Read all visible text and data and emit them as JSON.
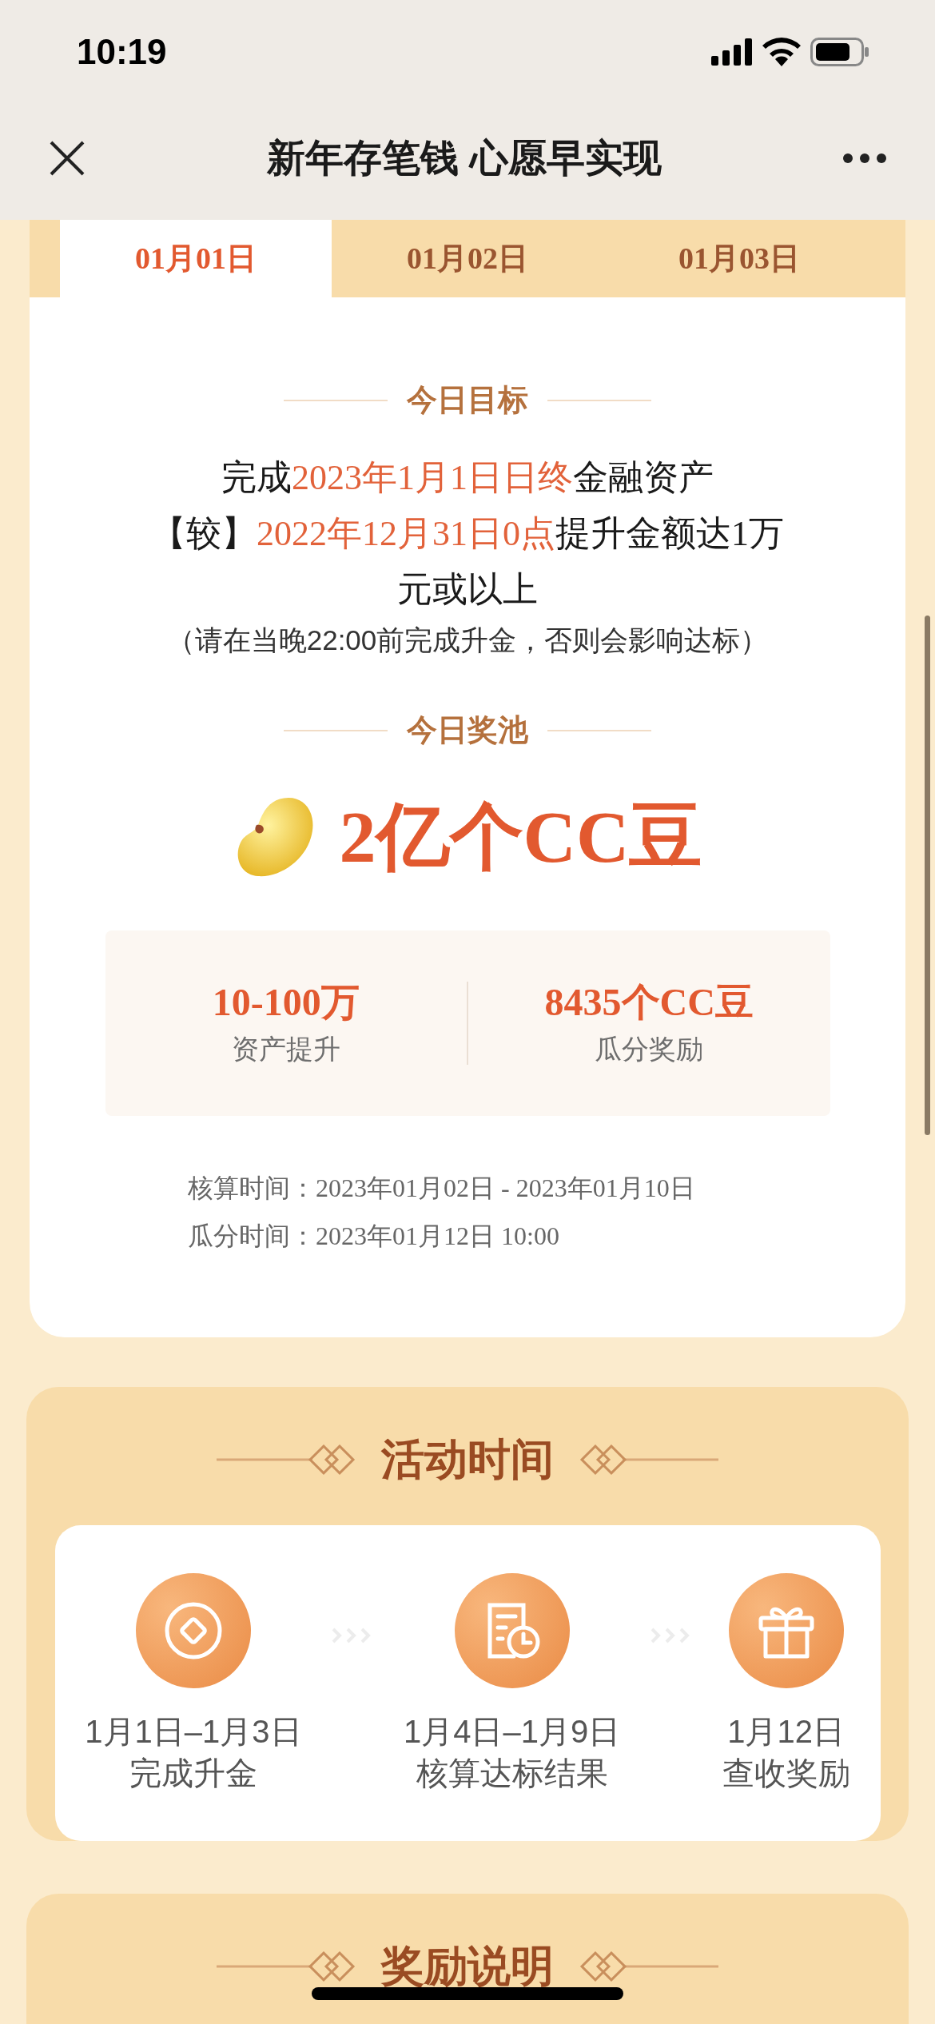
{
  "status_bar": {
    "time": "10:19"
  },
  "nav_bar": {
    "title": "新年存笔钱 心愿早实现"
  },
  "tabs": [
    {
      "label": "01月01日",
      "selected": true
    },
    {
      "label": "01月02日",
      "selected": false
    },
    {
      "label": "01月03日",
      "selected": false
    }
  ],
  "goal": {
    "heading": "今日目标",
    "lines": [
      [
        {
          "text": "完成",
          "highlight": false
        },
        {
          "text": "2023年1月1日日终",
          "highlight": true
        },
        {
          "text": "金融资产",
          "highlight": false
        }
      ],
      [
        {
          "text": "【较】",
          "highlight": false
        },
        {
          "text": "2022年12月31日0点",
          "highlight": true
        },
        {
          "text": "提升金额达1万",
          "highlight": false
        }
      ],
      [
        {
          "text": "元或以上",
          "highlight": false
        }
      ]
    ],
    "note": "（请在当晚22:00前完成升金，否则会影响达标）"
  },
  "pool": {
    "heading": "今日奖池",
    "amount": "2亿个CC豆"
  },
  "stats": [
    {
      "value": "10-100万",
      "label": "资产提升"
    },
    {
      "value": "8435个CC豆",
      "label": "瓜分奖励"
    }
  ],
  "times": [
    "核算时间：2023年01月02日 - 2023年01月10日",
    "瓜分时间：2023年01月12日 10:00"
  ],
  "activity": {
    "heading": "活动时间",
    "steps": [
      {
        "kind": "coin",
        "date": "1月1日–1月3日",
        "label": "完成升金"
      },
      {
        "kind": "document",
        "date": "1月4日–1月9日",
        "label": "核算达标结果"
      },
      {
        "kind": "gift",
        "date": "1月12日",
        "label": "查收奖励"
      }
    ]
  },
  "reward": {
    "heading": "奖励说明"
  }
}
